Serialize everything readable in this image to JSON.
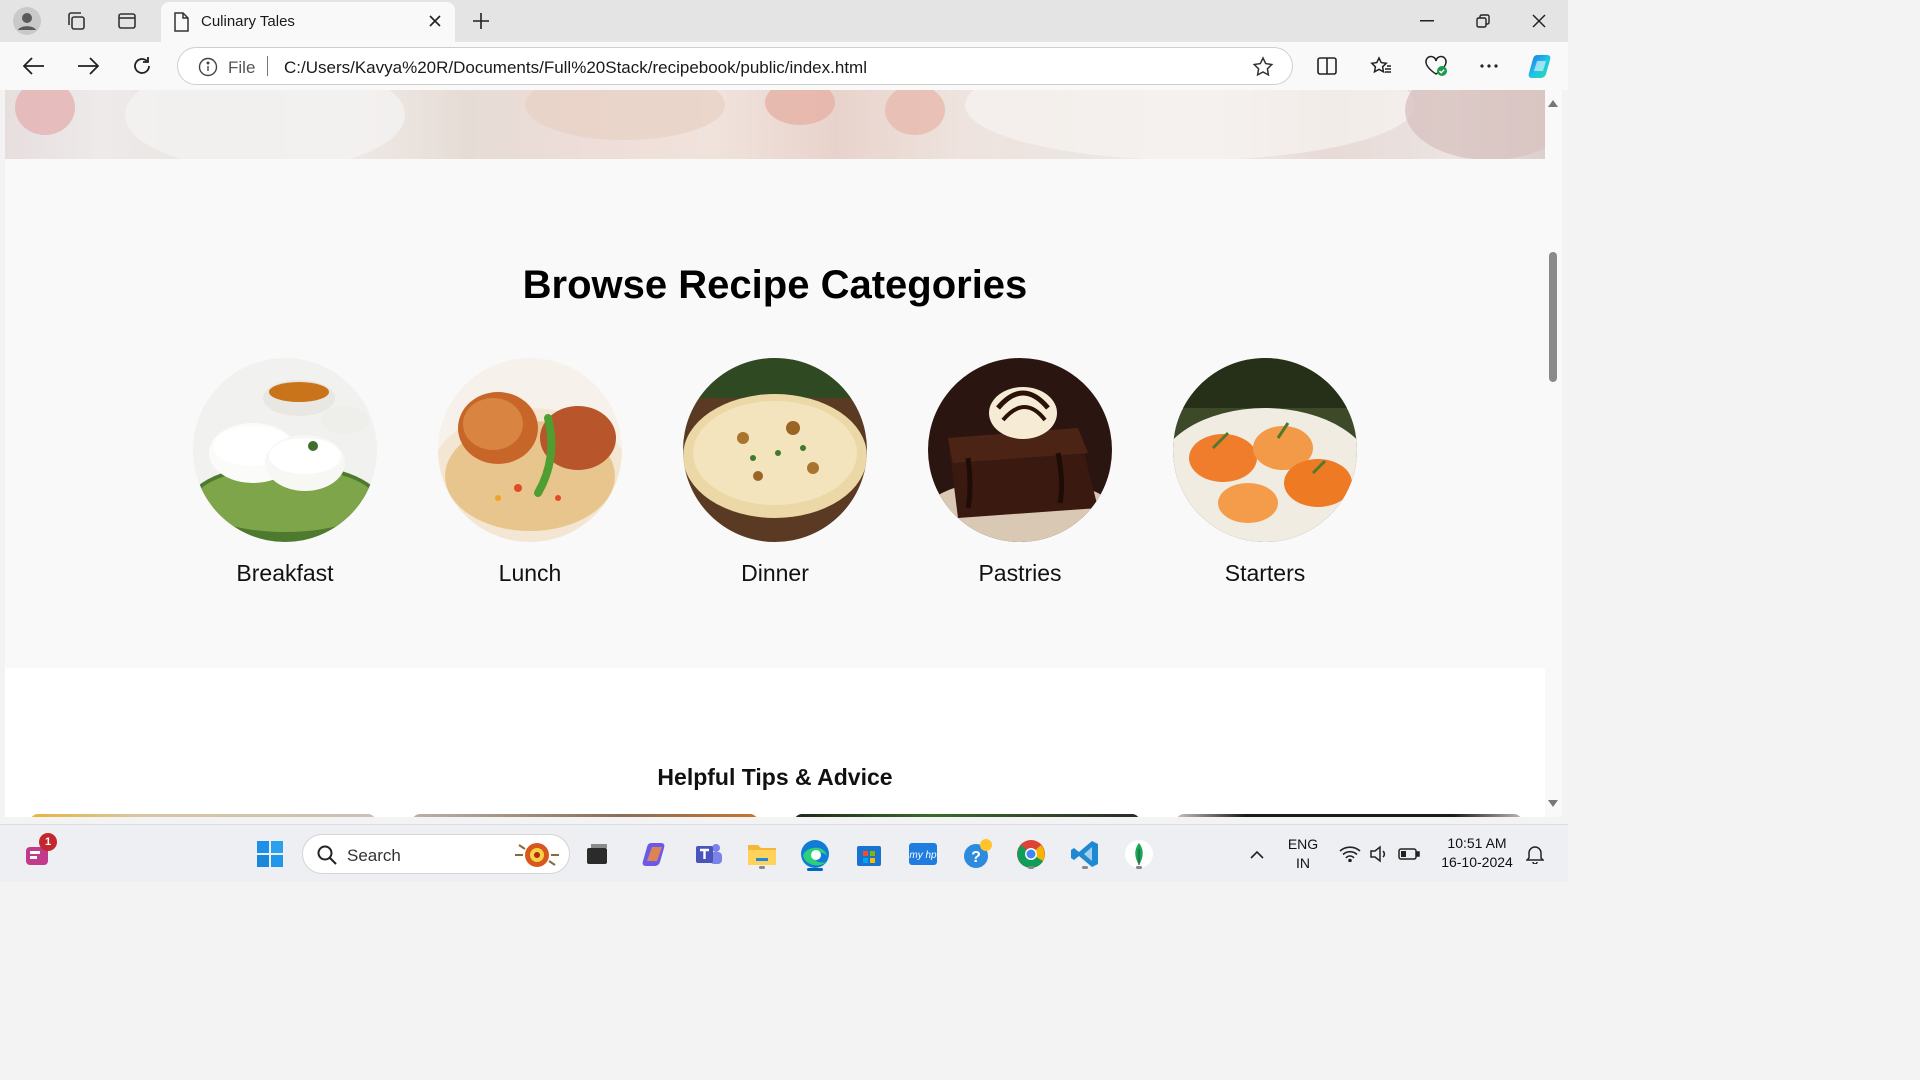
{
  "browser": {
    "tab_title": "Culinary Tales",
    "address_prefix": "File",
    "url": "C:/Users/Kavya%20R/Documents/Full%20Stack/recipebook/public/index.html"
  },
  "page": {
    "categories_title": "Browse Recipe Categories",
    "categories": [
      {
        "label": "Breakfast"
      },
      {
        "label": "Lunch"
      },
      {
        "label": "Dinner"
      },
      {
        "label": "Pastries"
      },
      {
        "label": "Starters"
      }
    ],
    "tips_title": "Helpful Tips & Advice"
  },
  "taskbar": {
    "search_placeholder": "Search",
    "notification_badge": "1",
    "language": "ENG",
    "region": "IN",
    "time": "10:51 AM",
    "date": "16-10-2024"
  },
  "colors": {
    "accent": "#0067c0",
    "page_section_bg": "#f9f9f9"
  }
}
